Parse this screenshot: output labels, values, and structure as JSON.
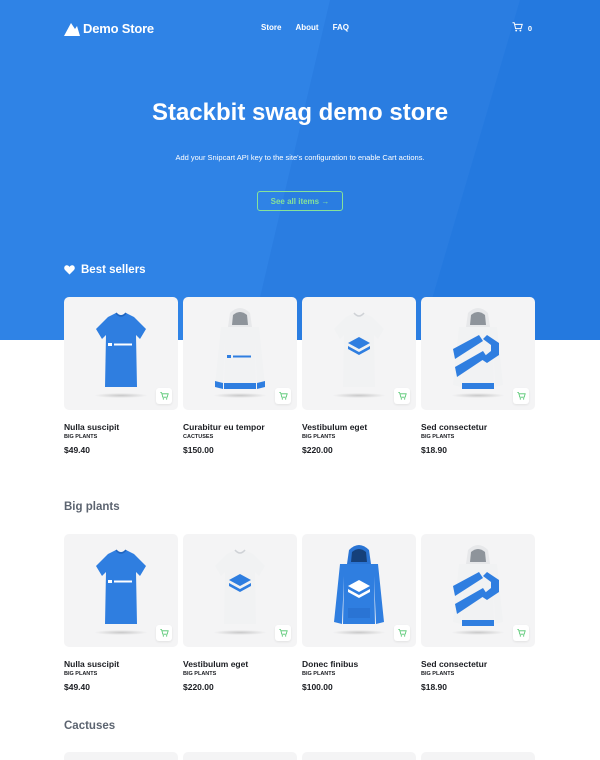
{
  "brand": {
    "name": "Demo Store"
  },
  "nav": [
    {
      "label": "Store"
    },
    {
      "label": "About"
    },
    {
      "label": "FAQ"
    }
  ],
  "cart": {
    "count": "0",
    "icon": "cart-icon"
  },
  "hero": {
    "title": "Stackbit swag demo store",
    "subtitle": "Add your Snipcart API key to the site's configuration to enable Cart actions.",
    "cta": "See all items →"
  },
  "colors": {
    "hero_bg": "#2a7de1",
    "accent": "#86e29a",
    "product_blue": "#2f7ee0"
  },
  "sections": {
    "best_sellers": {
      "title": "Best sellers",
      "icon": "heart-icon",
      "products": [
        {
          "name": "Nulla suscipit",
          "category": "BIG PLANTS",
          "price": "$49.40",
          "image": "blue-tshirt"
        },
        {
          "name": "Curabitur eu tempor",
          "category": "CACTUSES",
          "price": "$150.00",
          "image": "white-hoodie"
        },
        {
          "name": "Vestibulum eget",
          "category": "BIG PLANTS",
          "price": "$220.00",
          "image": "white-tshirt"
        },
        {
          "name": "Sed consectetur",
          "category": "BIG PLANTS",
          "price": "$18.90",
          "image": "white-hoodie-striped"
        }
      ]
    },
    "big_plants": {
      "title": "Big plants",
      "products": [
        {
          "name": "Nulla suscipit",
          "category": "BIG PLANTS",
          "price": "$49.40",
          "image": "blue-tshirt"
        },
        {
          "name": "Vestibulum eget",
          "category": "BIG PLANTS",
          "price": "$220.00",
          "image": "white-tshirt"
        },
        {
          "name": "Donec finibus",
          "category": "BIG PLANTS",
          "price": "$100.00",
          "image": "blue-hoodie"
        },
        {
          "name": "Sed consectetur",
          "category": "BIG PLANTS",
          "price": "$18.90",
          "image": "white-hoodie-striped"
        }
      ]
    },
    "cactuses": {
      "title": "Cactuses"
    }
  }
}
